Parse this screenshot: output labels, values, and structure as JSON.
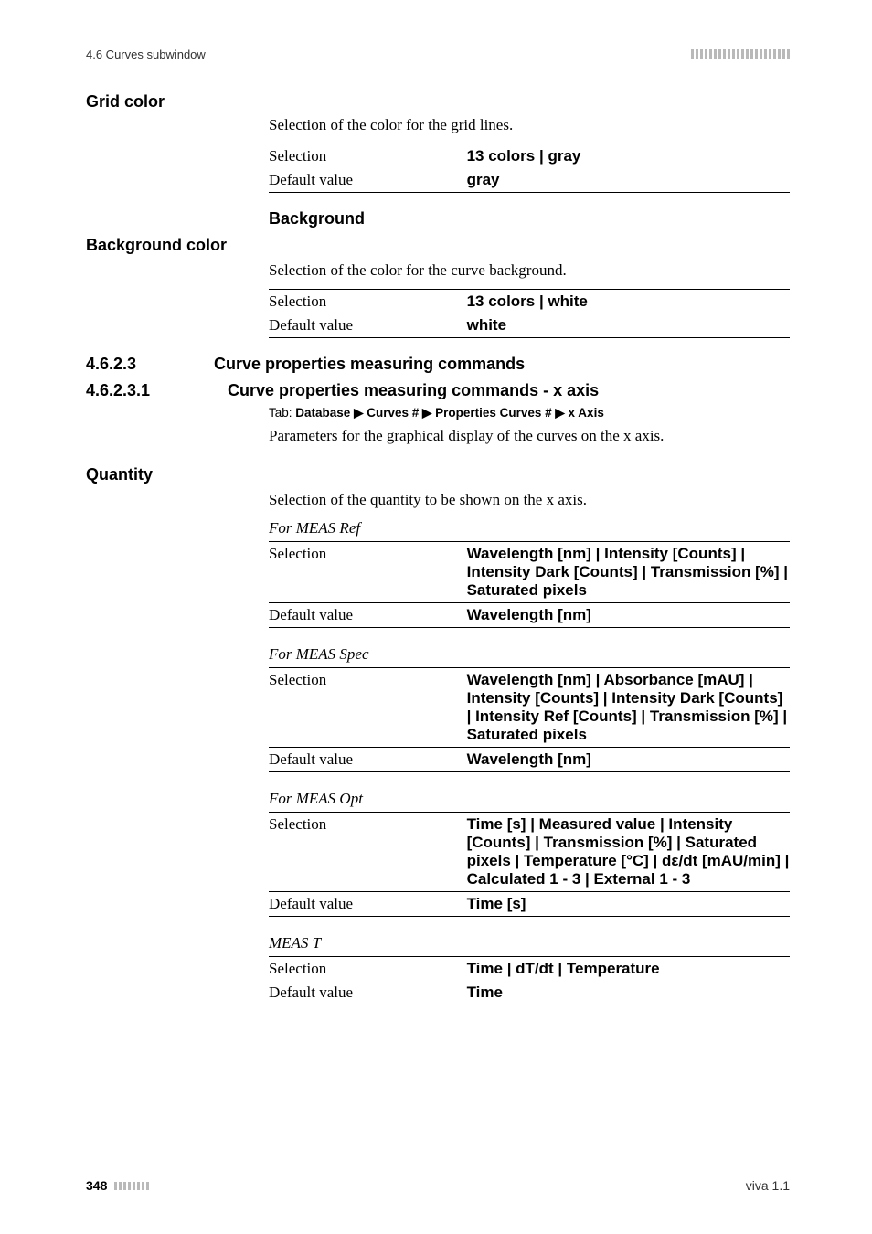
{
  "running_head": {
    "left": "4.6 Curves subwindow"
  },
  "grid_color": {
    "title": "Grid color",
    "desc": "Selection of the color for the grid lines.",
    "selection_label": "Selection",
    "selection_value": "13 colors | gray",
    "default_label": "Default value",
    "default_value": "gray"
  },
  "background": {
    "heading": "Background",
    "title": "Background color",
    "desc": "Selection of the color for the curve background.",
    "selection_label": "Selection",
    "selection_value": "13 colors | white",
    "default_label": "Default value",
    "default_value": "white"
  },
  "sec_4623": {
    "num": "4.6.2.3",
    "title": "Curve properties measuring commands"
  },
  "sec_46231": {
    "num": "4.6.2.3.1",
    "title": "Curve properties measuring commands - x axis",
    "tab": "Tab: Database ▶ Curves # ▶ Properties Curves # ▶ x Axis",
    "desc": "Parameters for the graphical display of the curves on the x axis."
  },
  "quantity": {
    "title": "Quantity",
    "desc": "Selection of the quantity to be shown on the x axis.",
    "groups": [
      {
        "caption": "For MEAS Ref",
        "selection_label": "Selection",
        "selection_value": "Wavelength [nm] | Intensity [Counts] | Intensity Dark [Counts] | Transmission [%] | Saturated pixels",
        "default_label": "Default value",
        "default_value": "Wavelength [nm]"
      },
      {
        "caption": "For MEAS Spec",
        "selection_label": "Selection",
        "selection_value": "Wavelength [nm] | Absorbance [mAU] | Intensity [Counts] | Intensity Dark [Counts] | Intensity Ref [Counts] | Transmission [%] | Saturated pixels",
        "default_label": "Default value",
        "default_value": "Wavelength [nm]"
      },
      {
        "caption": "For MEAS Opt",
        "selection_label": "Selection",
        "selection_value": "Time [s] | Measured value | Intensity [Counts] | Transmission [%] | Saturated pixels | Temperature [°C] | dε/dt [mAU/min] | Calculated 1 - 3 | External 1 - 3",
        "default_label": "Default value",
        "default_value": "Time [s]"
      },
      {
        "caption": "MEAS T",
        "selection_label": "Selection",
        "selection_value": "Time | dT/dt | Temperature",
        "default_label": "Default value",
        "default_value": "Time"
      }
    ]
  },
  "footer": {
    "page": "348",
    "viva": "viva 1.1"
  },
  "chart_data": {
    "type": "table",
    "title": "Curve property option tables",
    "tables": [
      {
        "name": "Grid color",
        "rows": [
          [
            "Selection",
            "13 colors | gray"
          ],
          [
            "Default value",
            "gray"
          ]
        ]
      },
      {
        "name": "Background color",
        "rows": [
          [
            "Selection",
            "13 colors | white"
          ],
          [
            "Default value",
            "white"
          ]
        ]
      },
      {
        "name": "Quantity — For MEAS Ref",
        "rows": [
          [
            "Selection",
            "Wavelength [nm] | Intensity [Counts] | Intensity Dark [Counts] | Transmission [%] | Saturated pixels"
          ],
          [
            "Default value",
            "Wavelength [nm]"
          ]
        ]
      },
      {
        "name": "Quantity — For MEAS Spec",
        "rows": [
          [
            "Selection",
            "Wavelength [nm] | Absorbance [mAU] | Intensity [Counts] | Intensity Dark [Counts] | Intensity Ref [Counts] | Transmission [%] | Saturated pixels"
          ],
          [
            "Default value",
            "Wavelength [nm]"
          ]
        ]
      },
      {
        "name": "Quantity — For MEAS Opt",
        "rows": [
          [
            "Selection",
            "Time [s] | Measured value | Intensity [Counts] | Transmission [%] | Saturated pixels | Temperature [°C] | dε/dt [mAU/min] | Calculated 1 - 3 | External 1 - 3"
          ],
          [
            "Default value",
            "Time [s]"
          ]
        ]
      },
      {
        "name": "Quantity — MEAS T",
        "rows": [
          [
            "Selection",
            "Time | dT/dt | Temperature"
          ],
          [
            "Default value",
            "Time"
          ]
        ]
      }
    ]
  }
}
